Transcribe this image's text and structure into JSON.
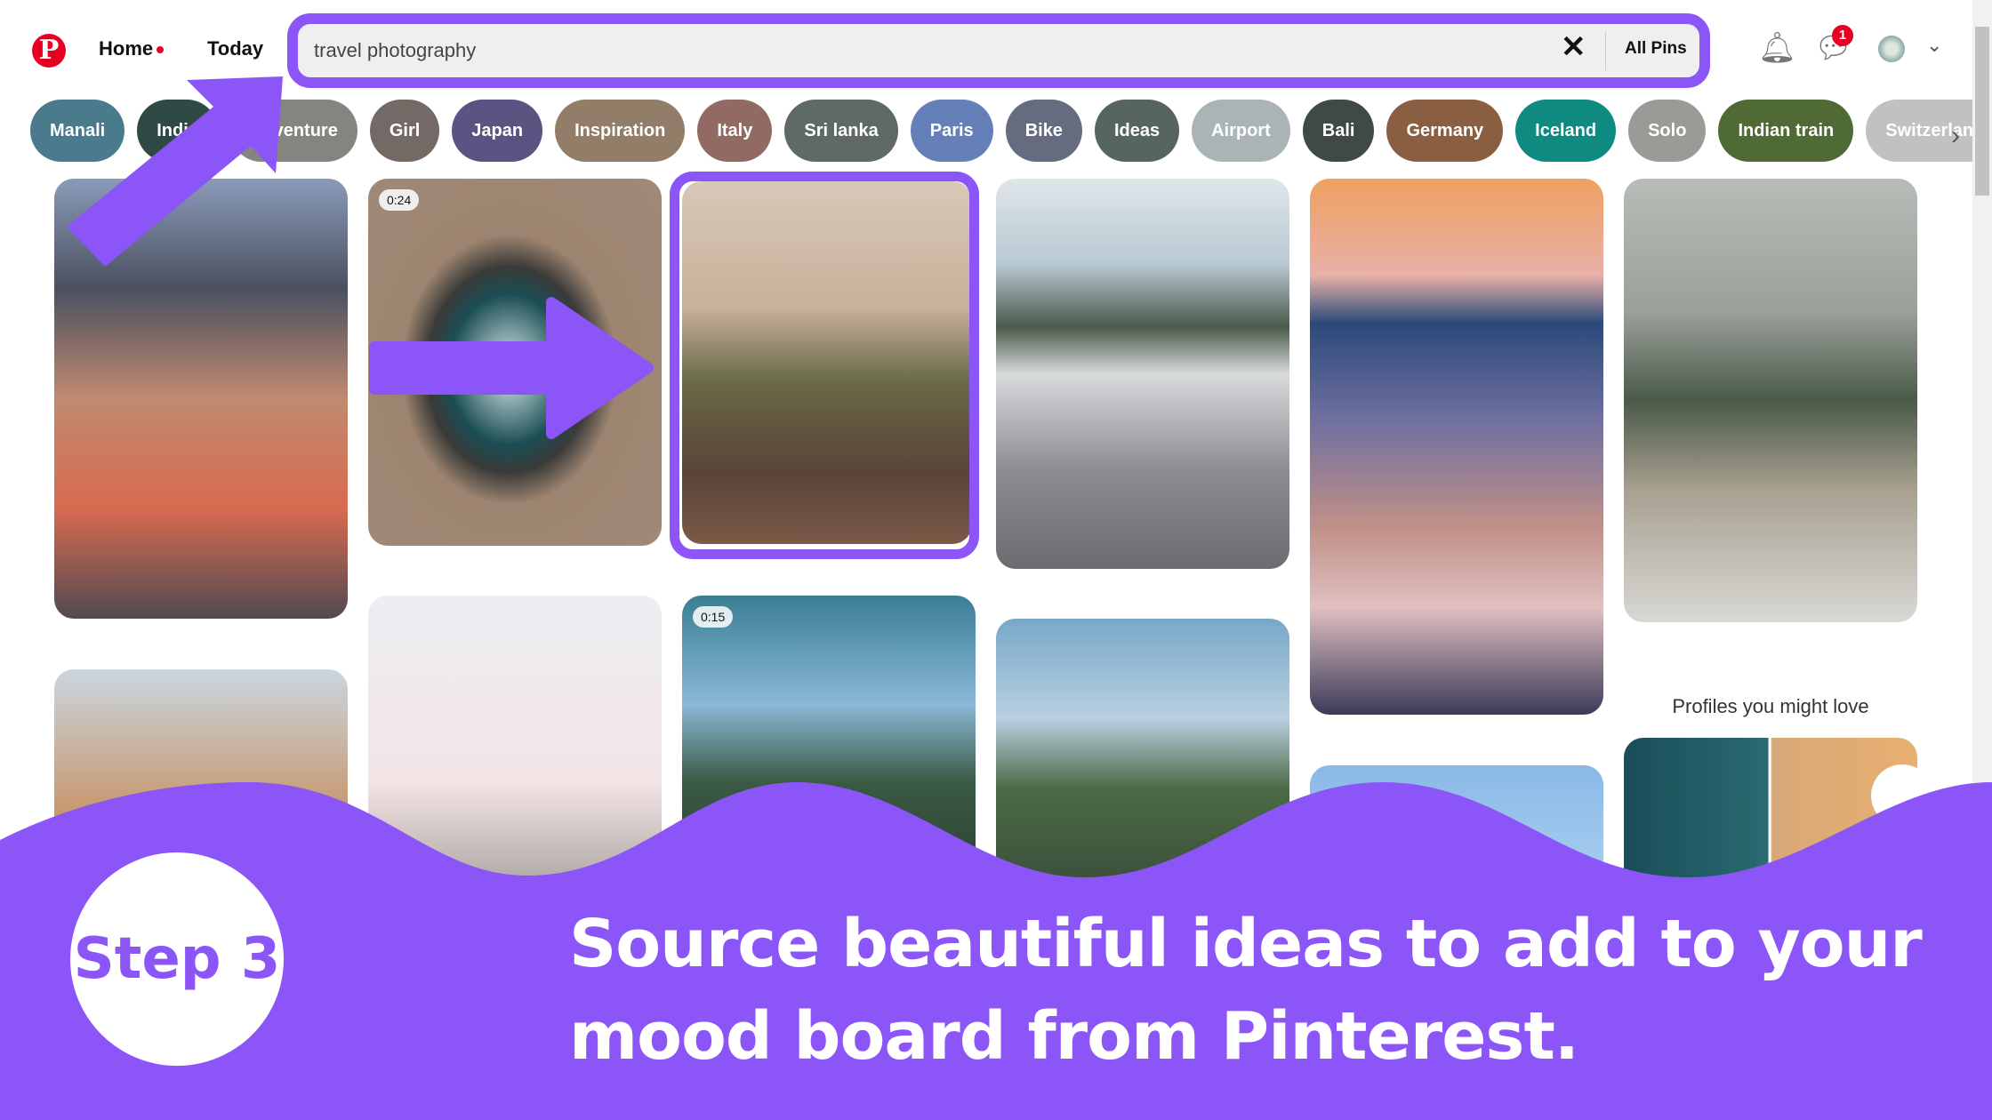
{
  "header": {
    "logo": "P",
    "home": "Home",
    "today": "Today",
    "search_value": "travel photography",
    "clear_icon": "close-icon",
    "filter": "All Pins",
    "messages_badge": "1"
  },
  "chips": [
    {
      "label": "Manali",
      "color": "#4a7b8c"
    },
    {
      "label": "India",
      "color": "#2f4a44"
    },
    {
      "label": "Adventure",
      "color": "#858580"
    },
    {
      "label": "Girl",
      "color": "#736a66"
    },
    {
      "label": "Japan",
      "color": "#5a5483"
    },
    {
      "label": "Inspiration",
      "color": "#927d68"
    },
    {
      "label": "Italy",
      "color": "#926a64"
    },
    {
      "label": "Sri lanka",
      "color": "#5e6968"
    },
    {
      "label": "Paris",
      "color": "#6580b8"
    },
    {
      "label": "Bike",
      "color": "#656c80"
    },
    {
      "label": "Ideas",
      "color": "#56665f"
    },
    {
      "label": "Airport",
      "color": "#aab4b6"
    },
    {
      "label": "Bali",
      "color": "#3f4a44"
    },
    {
      "label": "Germany",
      "color": "#8a5e40"
    },
    {
      "label": "Iceland",
      "color": "#0e8a80"
    },
    {
      "label": "Solo",
      "color": "#9b9a96"
    },
    {
      "label": "Indian train",
      "color": "#4f6a34"
    },
    {
      "label": "Switzerland",
      "color": "#c0c2c0"
    }
  ],
  "pins": {
    "video1_duration": "0:24",
    "video2_duration": "0:15",
    "profiles_heading": "Profiles you might love"
  },
  "overlay": {
    "step": "Step 3",
    "caption_line1": "Source beautiful ideas to add to your",
    "caption_line2": "mood board from Pinterest.",
    "accent": "#8b55f7"
  }
}
